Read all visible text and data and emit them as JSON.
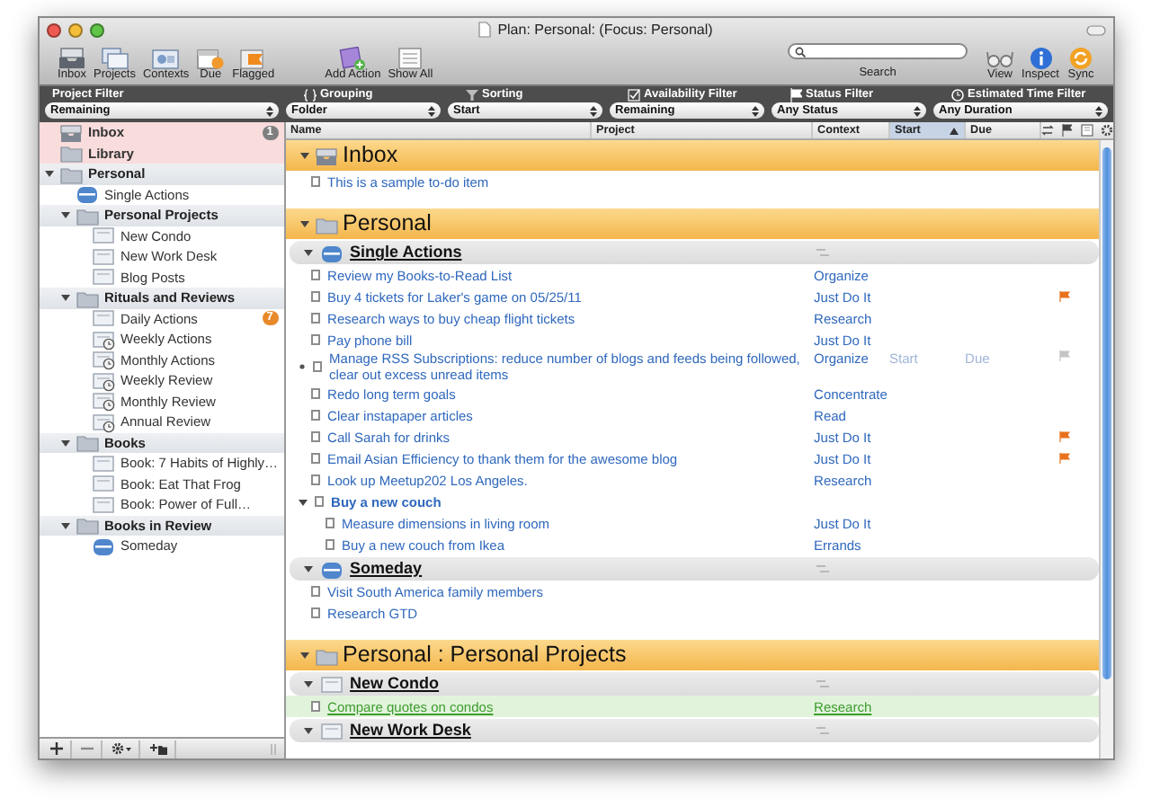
{
  "window": {
    "title": "Plan: Personal:  (Focus: Personal)"
  },
  "toolbar": {
    "left": [
      {
        "kind": "inbox",
        "label": "Inbox"
      },
      {
        "kind": "projects",
        "label": "Projects"
      },
      {
        "kind": "contexts",
        "label": "Contexts"
      },
      {
        "kind": "due",
        "label": "Due"
      },
      {
        "kind": "flagged",
        "label": "Flagged"
      }
    ],
    "middle": [
      {
        "kind": "add",
        "label": "Add Action"
      },
      {
        "kind": "showall",
        "label": "Show All"
      }
    ],
    "search": {
      "label": "Search"
    },
    "right": [
      {
        "kind": "view",
        "label": "View"
      },
      {
        "kind": "inspect",
        "label": "Inspect"
      },
      {
        "kind": "sync",
        "label": "Sync"
      }
    ]
  },
  "filters": [
    {
      "kind": "project",
      "label": "Project Filter",
      "value": "Remaining"
    },
    {
      "kind": "grouping",
      "label": "Grouping",
      "value": "Folder"
    },
    {
      "kind": "sorting",
      "label": "Sorting",
      "value": "Start"
    },
    {
      "kind": "availability",
      "label": "Availability Filter",
      "value": "Remaining"
    },
    {
      "kind": "status",
      "label": "Status Filter",
      "value": "Any Status"
    },
    {
      "kind": "time",
      "label": "Estimated Time Filter",
      "value": "Any Duration"
    }
  ],
  "sidebar": {
    "items": [
      {
        "kind": "inbox",
        "label": "Inbox",
        "selected": true,
        "badge": "1",
        "color": "#7f7f7f"
      },
      {
        "kind": "library",
        "label": "Library",
        "selected": true
      },
      {
        "kind": "folder",
        "label": "Personal",
        "selected": false,
        "expanded": true,
        "children": [
          {
            "kind": "single",
            "label": "Single Actions",
            "selected": false
          },
          {
            "kind": "folder",
            "label": "Personal Projects",
            "selected": false,
            "expanded": true,
            "children": [
              {
                "kind": "project",
                "label": "New Condo",
                "selected": false
              },
              {
                "kind": "project",
                "label": "New Work Desk",
                "selected": false
              },
              {
                "kind": "project",
                "label": "Blog Posts",
                "selected": false
              }
            ]
          },
          {
            "kind": "folder",
            "label": "Rituals and Reviews",
            "selected": false,
            "expanded": true,
            "children": [
              {
                "kind": "project",
                "label": "Daily Actions",
                "selected": false,
                "badge": "7",
                "color": "#e8892a"
              },
              {
                "kind": "repeat",
                "label": "Weekly Actions",
                "selected": false
              },
              {
                "kind": "repeat",
                "label": "Monthly Actions",
                "selected": false
              },
              {
                "kind": "repeat",
                "label": "Weekly Review",
                "selected": false
              },
              {
                "kind": "repeat",
                "label": "Monthly Review",
                "selected": false
              },
              {
                "kind": "repeat",
                "label": "Annual Review",
                "selected": false
              }
            ]
          },
          {
            "kind": "folder",
            "label": "Books",
            "selected": false,
            "expanded": true,
            "children": [
              {
                "kind": "project",
                "label": "Book: 7 Habits of Highly…",
                "selected": false
              },
              {
                "kind": "project",
                "label": "Book: Eat That Frog",
                "selected": false
              },
              {
                "kind": "project",
                "label": "Book: Power of Full…",
                "selected": false
              }
            ]
          },
          {
            "kind": "folder",
            "label": "Books in Review",
            "selected": false,
            "expanded": true,
            "children": [
              {
                "kind": "single",
                "label": "Someday",
                "selected": false
              }
            ]
          }
        ]
      }
    ]
  },
  "columns": [
    {
      "label": "Name",
      "selected": false
    },
    {
      "label": "Project",
      "selected": false
    },
    {
      "label": "Context",
      "selected": false
    },
    {
      "label": "Start",
      "selected": true
    },
    {
      "label": "Due",
      "selected": false
    }
  ],
  "groups": [
    {
      "kind": "inbox",
      "title": "Inbox",
      "expanded": true,
      "items": [
        {
          "name": "This is a sample to-do item",
          "selected": false,
          "flagged": false
        }
      ]
    },
    {
      "kind": "folder",
      "title": "Personal",
      "expanded": true,
      "projects": [
        {
          "kind": "single",
          "title": "Single Actions",
          "expanded": true,
          "items": [
            {
              "name": "Review my Books-to-Read List",
              "context": "Organize",
              "selected": false,
              "flagged": false
            },
            {
              "name": "Buy 4 tickets for Laker's game on 05/25/11",
              "context": "Just Do It",
              "selected": false,
              "flagged": true
            },
            {
              "name": "Research ways to buy cheap flight tickets",
              "context": "Research",
              "selected": false,
              "flagged": false
            },
            {
              "name": "Pay phone bill",
              "context": "Just Do It",
              "selected": false,
              "flagged": false
            },
            {
              "name": "Manage RSS Subscriptions: reduce number of blogs and feeds being followed, clear out excess unread items",
              "context": "Organize",
              "start_placeholder": "Start",
              "due_placeholder": "Due",
              "selected": false,
              "flagged": false
            },
            {
              "name": "Redo long term goals",
              "context": "Concentrate",
              "selected": false,
              "flagged": false
            },
            {
              "name": "Clear instapaper articles",
              "context": "Read",
              "selected": false,
              "flagged": false
            },
            {
              "name": "Call Sarah for drinks",
              "context": "Just Do It",
              "selected": false,
              "flagged": true
            },
            {
              "name": "Email Asian Efficiency to thank them for the awesome blog",
              "context": "Just Do It",
              "selected": false,
              "flagged": true
            },
            {
              "name": "Look up Meetup202 Los Angeles.",
              "context": "Research",
              "selected": false,
              "flagged": false
            },
            {
              "name": "Buy a new couch",
              "selected": false,
              "flagged": false,
              "expanded": true,
              "children": [
                {
                  "name": "Measure dimensions in living room",
                  "context": "Just Do It",
                  "selected": false,
                  "flagged": false
                },
                {
                  "name": "Buy a new couch from Ikea",
                  "context": "Errands",
                  "selected": false,
                  "flagged": false
                }
              ]
            }
          ]
        },
        {
          "kind": "single",
          "title": "Someday",
          "expanded": true,
          "items": [
            {
              "name": "Visit South America family members",
              "selected": false,
              "flagged": false
            },
            {
              "name": "Research GTD",
              "selected": false,
              "flagged": false
            }
          ]
        }
      ]
    },
    {
      "kind": "folder",
      "title": "Personal : Personal Projects",
      "expanded": true,
      "projects": [
        {
          "kind": "project",
          "title": "New Condo",
          "expanded": true,
          "items": [
            {
              "name": "Compare quotes on condos",
              "context": "Research",
              "selected": true,
              "flagged": false
            }
          ]
        },
        {
          "kind": "project",
          "title": "New Work Desk",
          "expanded": true
        }
      ]
    }
  ]
}
